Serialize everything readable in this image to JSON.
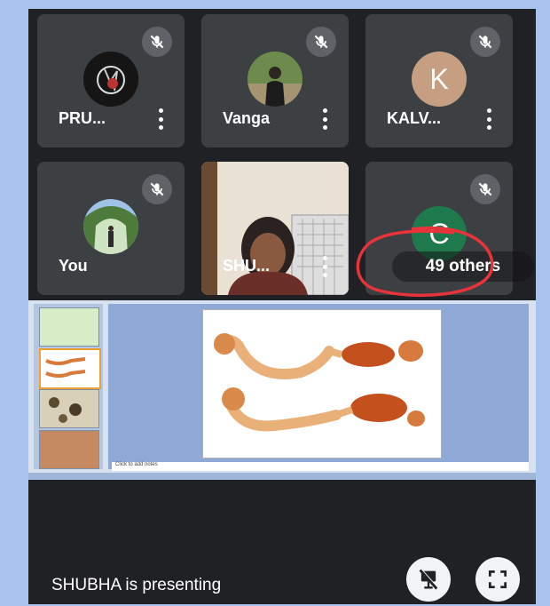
{
  "participants": [
    {
      "name": "PRU..."
    },
    {
      "name": "Vanga"
    },
    {
      "name": "KALV...",
      "initial": "K"
    },
    {
      "name": "You"
    },
    {
      "name": "SHU..."
    },
    {
      "name": "C",
      "others": "49 others"
    }
  ],
  "presentation": {
    "notes_placeholder": "Click to add notes"
  },
  "footer": {
    "presenting_text": "SHUBHA is presenting"
  },
  "colors": {
    "page_background": "#a9c4ec",
    "tile_background": "#3c4043",
    "highlight_circle": "#e8333b"
  },
  "icons": {
    "muted": "mic-off-icon",
    "more": "more-vert-icon",
    "stop_presenting": "present-off-icon",
    "fullscreen": "fullscreen-icon"
  }
}
